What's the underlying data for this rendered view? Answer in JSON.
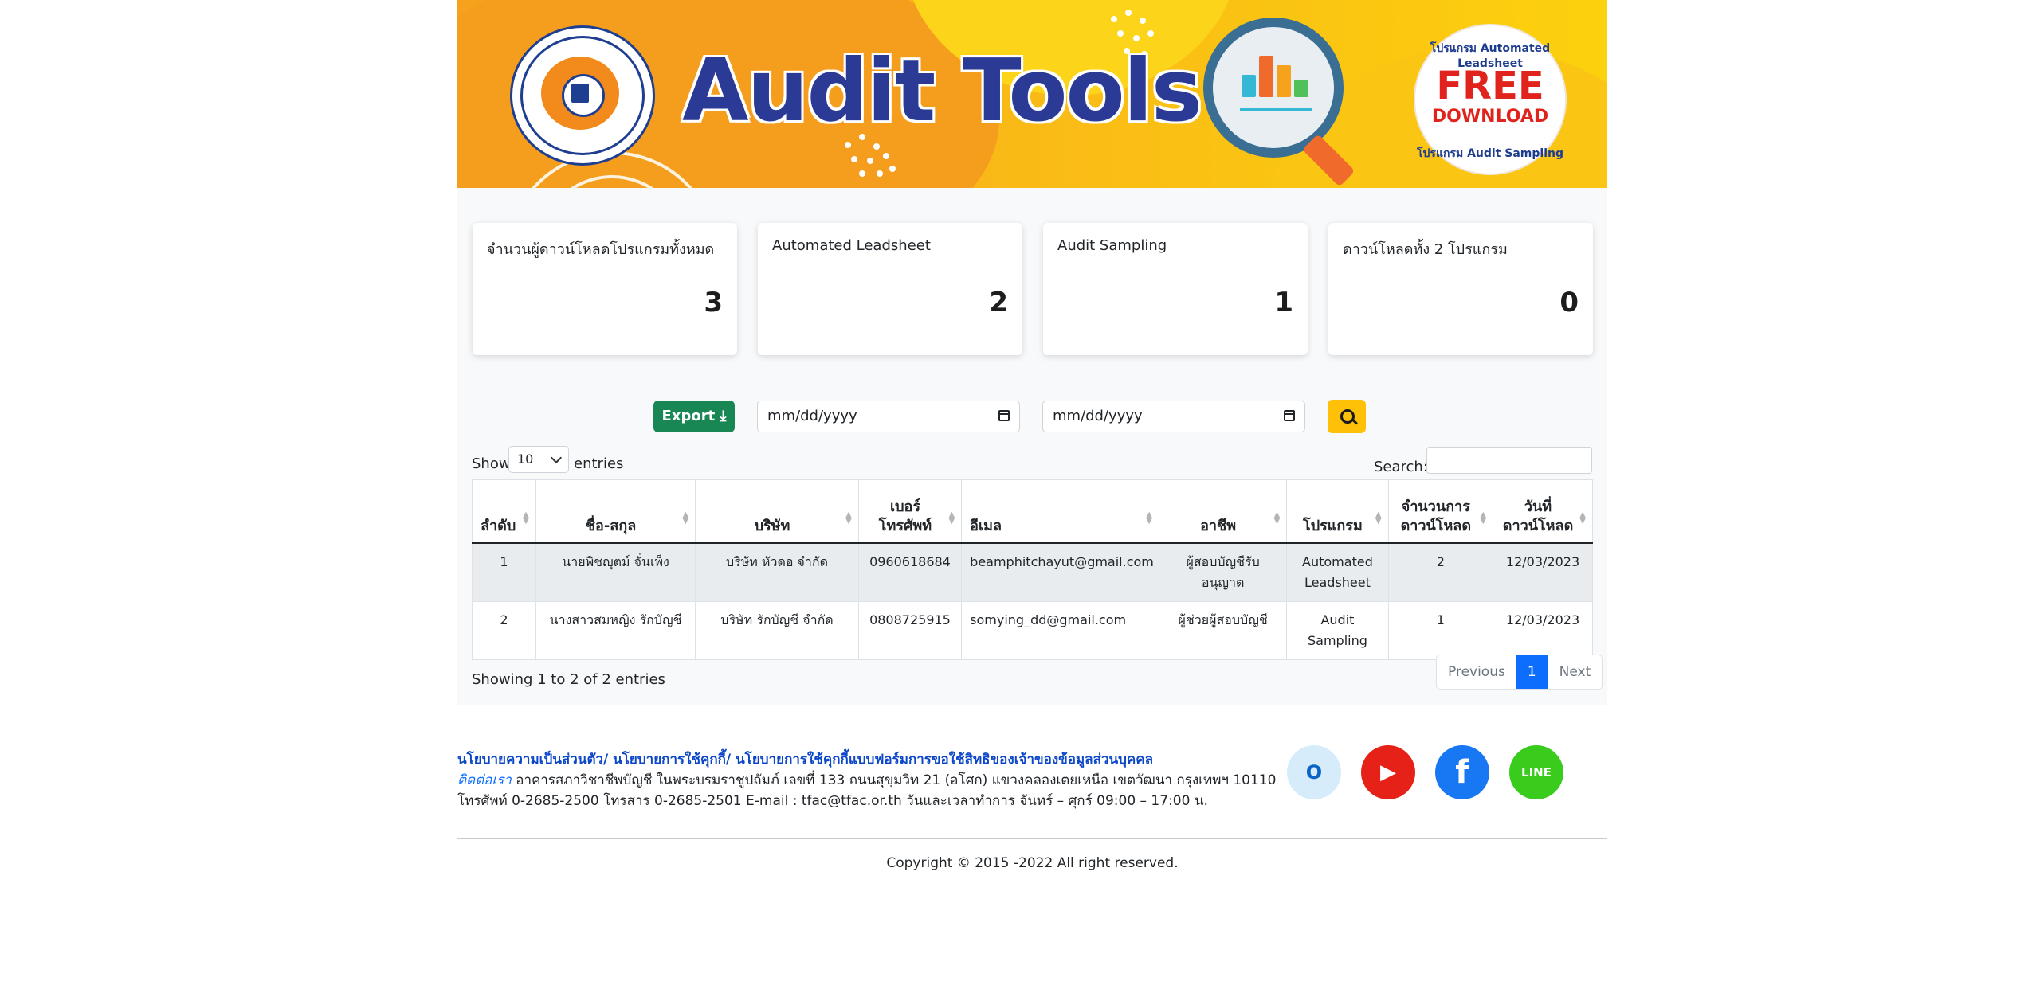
{
  "banner": {
    "title": "Audit Tools",
    "badge": {
      "top_text": "โปรแกรม Automated Leadsheet",
      "free": "FREE",
      "download": "DOWNLOAD",
      "bottom_text": "โปรแกรม Audit Sampling"
    }
  },
  "stats": [
    {
      "label": "จำนวนผู้ดาวน์โหลดโปรแกรมทั้งหมด",
      "value": "3"
    },
    {
      "label": "Automated Leadsheet",
      "value": "2"
    },
    {
      "label": "Audit Sampling",
      "value": "1"
    },
    {
      "label": "ดาวน์โหลดทั้ง 2 โปรแกรม",
      "value": "0"
    }
  ],
  "toolbar": {
    "export_label": "Export",
    "date_from_placeholder": "mm/dd/yyyy",
    "date_to_placeholder": "mm/dd/yyyy"
  },
  "table": {
    "show_label": "Show",
    "page_length": "10",
    "entries_label": "entries",
    "search_label": "Search:",
    "columns": [
      "ลำดับ",
      "ชื่อ-สกุล",
      "บริษัท",
      "เบอร์",
      "โทรศัพท์",
      "อีเมล",
      "อาชีพ",
      "โปรแกรม",
      "จำนวนการ",
      "ดาวน์โหลด",
      "วันที่",
      "ดาวน์โหลด"
    ],
    "rows": [
      {
        "no": "1",
        "name": "นายพิชญุตม์ จั่นเพ็ง",
        "company": "บริษัท หัวดอ จำกัด",
        "phone": "0960618684",
        "email": "beamphitchayut@gmail.com",
        "occupation_1": "ผู้สอบบัญชีรับ",
        "occupation_2": "อนุญาต",
        "program_1": "Automated",
        "program_2": "Leadsheet",
        "downloads": "2",
        "date": "12/03/2023"
      },
      {
        "no": "2",
        "name": "นางสาวสมหญิง รักบัญชี",
        "company": "บริษัท รักบัญชี จำกัด",
        "phone": "0808725915",
        "email": "somying_dd@gmail.com",
        "occupation_1": "ผู้ช่วยผู้สอบบัญชี",
        "occupation_2": "",
        "program_1": "Audit",
        "program_2": "Sampling",
        "downloads": "1",
        "date": "12/03/2023"
      }
    ],
    "info": "Showing 1 to 2 of 2 entries",
    "pagination": {
      "previous": "Previous",
      "current": "1",
      "next": "Next"
    }
  },
  "footer": {
    "links": "นโยบายความเป็นส่วนตัว/ นโยบายการใช้คุกกี้/ นโยบายการใช้คุกกี้แบบฟอร์มการขอใช้สิทธิของเจ้าของข้อมูลส่วนบุคคล",
    "contact_label": "ติดต่อเรา",
    "contact_address": " อาคารสภาวิชาชีพบัญชี ในพระบรมราชูปถัมภ์ เลขที่ 133 ถนนสุขุมวิท 21 (อโศก) แขวงคลองเตยเหนือ เขตวัฒนา กรุงเทพฯ 10110",
    "phone_line": "โทรศัพท์ 0-2685-2500 โทรสาร 0-2685-2501 E-mail : tfac@tfac.or.th วันและเวลาทำการ จันทร์ – ศุกร์ 09:00 – 17:00 น.",
    "social_icons": [
      "outlook-icon",
      "youtube-icon",
      "facebook-icon",
      "line-icon"
    ],
    "line_text": "LINE",
    "copyright": "Copyright © 2015 -2022 All right reserved."
  },
  "colors": {
    "banner_orange": "#f6a21c",
    "banner_yellow": "#fcd10d",
    "title_blue": "#2b3a95",
    "export_green": "#198754",
    "search_yellow": "#ffc107",
    "active_blue": "#0d6efd",
    "youtube_red": "#e62117",
    "facebook_blue": "#1877f2",
    "line_green": "#3acc1c"
  }
}
